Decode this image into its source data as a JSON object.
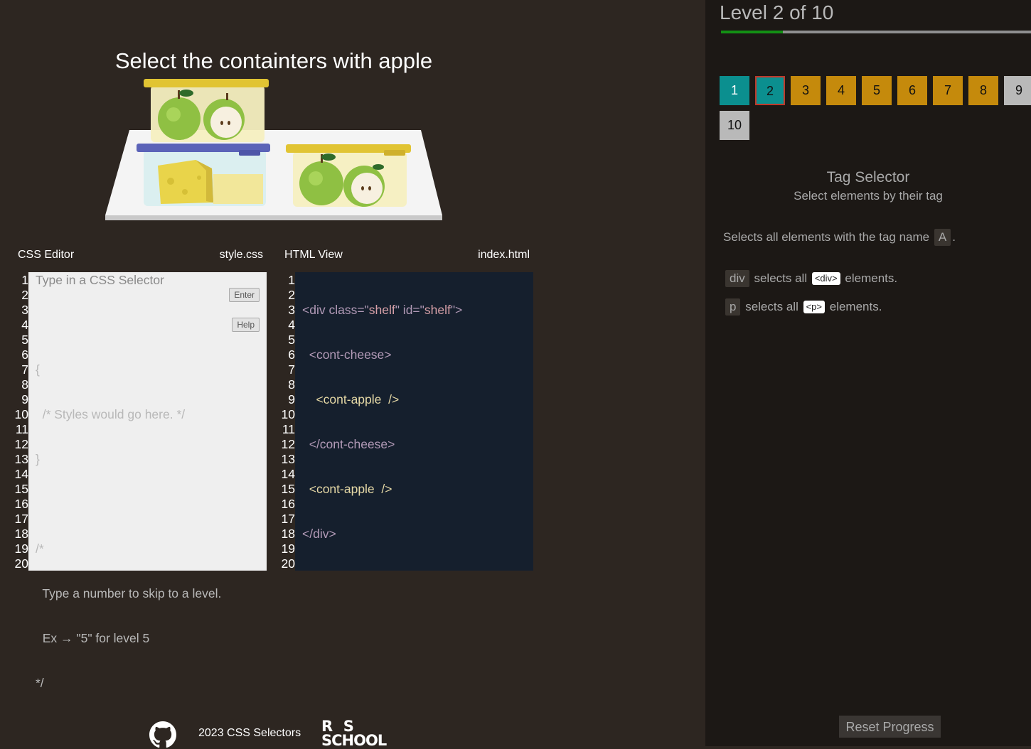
{
  "game": {
    "order": "Select the containters with apple"
  },
  "css_editor": {
    "title": "CSS Editor",
    "filename": "style.css",
    "placeholder": "Type in a CSS Selector",
    "enter_label": "Enter",
    "help_label": "Help",
    "line_numbers": [
      "1",
      "2",
      "3",
      "4",
      "5",
      "6",
      "7",
      "8",
      "9",
      "10",
      "11",
      "12",
      "13",
      "14",
      "15",
      "16",
      "17",
      "18",
      "19",
      "20"
    ],
    "comment_lines": [
      "{",
      "  /* Styles would go here. */",
      "}",
      "",
      "/*",
      "  Type a number to skip to a level.",
      "  Ex → \"5\" for level 5",
      "*/"
    ]
  },
  "html_viewer": {
    "title": "HTML View",
    "filename": "index.html",
    "line_numbers": [
      "1",
      "2",
      "3",
      "4",
      "5",
      "6",
      "7",
      "8",
      "9",
      "10",
      "11",
      "12",
      "13",
      "14",
      "15",
      "16",
      "17",
      "18",
      "19",
      "20"
    ],
    "code": {
      "l1_open": "<div class=\"",
      "l1_class": "shelf",
      "l1_mid": "\" id=\"",
      "l1_id": "shelf",
      "l1_close": "\">",
      "l2": "  <cont-cheese>",
      "l3": "    <cont-apple  />",
      "l4": "  </cont-cheese>",
      "l5": "  <cont-apple  />",
      "l6": "</div>"
    }
  },
  "footer": {
    "copyright": "2023 CSS Selectors",
    "github_icon": "github-icon",
    "logo_top": "R  S",
    "logo_bottom": "SCHOOL"
  },
  "sidebar": {
    "level_title": "Level 2 of 10",
    "progress": 0.2,
    "levels": [
      {
        "label": "1",
        "state": "done"
      },
      {
        "label": "2",
        "state": "current"
      },
      {
        "label": "3",
        "state": "todo"
      },
      {
        "label": "4",
        "state": "todo"
      },
      {
        "label": "5",
        "state": "todo"
      },
      {
        "label": "6",
        "state": "todo"
      },
      {
        "label": "7",
        "state": "todo"
      },
      {
        "label": "8",
        "state": "todo"
      },
      {
        "label": "9",
        "state": "grey"
      },
      {
        "label": "10",
        "state": "grey"
      }
    ],
    "selector_name": "Tag Selector",
    "selector_description": "Select elements by their tag",
    "syntax_text": "Selects all elements with the tag name",
    "syntax_chip": "A",
    "syntax_end": ".",
    "examples": [
      {
        "chip": "div",
        "text_before": "selects all",
        "tag": "<div>",
        "text_after": "elements."
      },
      {
        "chip": "p",
        "text_before": "selects all",
        "tag": "<p>",
        "text_after": "elements."
      }
    ],
    "reset_label": "Reset Progress"
  },
  "colors": {
    "background": "#2d2621",
    "sidebar": "#1c1815",
    "level_done": "#0b8f8f",
    "level_todo": "#c58a0c",
    "progress": "#139014"
  }
}
